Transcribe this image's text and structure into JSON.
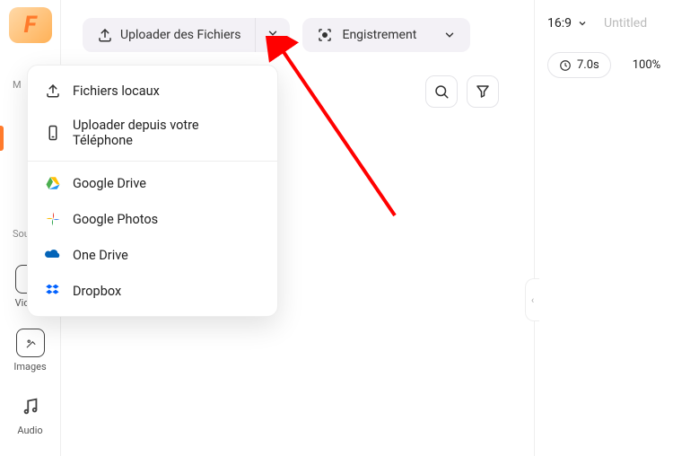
{
  "logo_letter": "F",
  "rail_stubs": {
    "a": "M",
    "b": "Sou"
  },
  "rail": {
    "videos": "Vidéos",
    "images": "Images",
    "audio": "Audio"
  },
  "toolbar": {
    "upload_label": "Uploader des Fichiers",
    "record_label": "Engistrement"
  },
  "dropdown": {
    "local": "Fichiers locaux",
    "phone": "Uploader depuis votre Téléphone",
    "gdrive": "Google Drive",
    "gphotos": "Google Photos",
    "onedrive": "One Drive",
    "dropbox": "Dropbox"
  },
  "right": {
    "aspect": "16:9",
    "title": "Untitled",
    "duration": "7.0s",
    "zoom": "100%"
  }
}
